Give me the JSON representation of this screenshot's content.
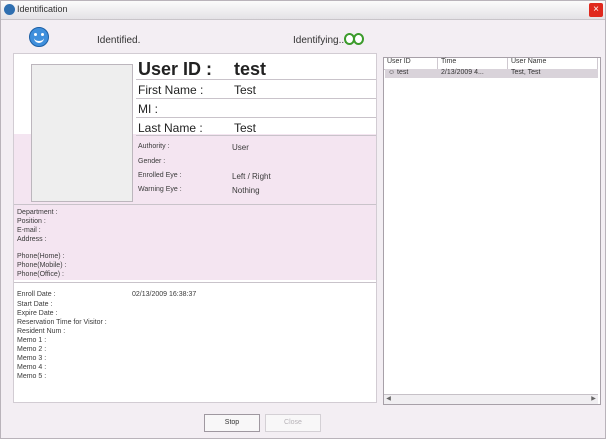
{
  "window": {
    "title": "Identification",
    "close_glyph": "×"
  },
  "status": {
    "identified": "Identified.",
    "identifying": "Identifying..."
  },
  "user": {
    "id_label": "User ID :",
    "id": "test",
    "first_name_label": "First Name :",
    "first_name": "Test",
    "mi_label": "MI :",
    "last_name_label": "Last Name :",
    "last_name": "Test"
  },
  "details": {
    "authority_label": "Authority :",
    "authority": "User",
    "gender_label": "Gender :",
    "enrolled_eye_label": "Enrolled Eye :",
    "enrolled_eye": "Left / Right",
    "warning_eye_label": "Warning Eye :",
    "warning_eye": "Nothing"
  },
  "contact": {
    "department": "Department :",
    "position": "Position :",
    "email": "E-mail :",
    "address": "Address :",
    "phone_home": "Phone(Home) :",
    "phone_mobile": "Phone(Mobile) :",
    "phone_office": "Phone(Office) :"
  },
  "extra": {
    "enroll_date_label": "Enroll Date :",
    "enroll_date": "02/13/2009 16:38:37",
    "start_date": "Start Date :",
    "expire_date": "Expire Date :",
    "reservation": "Reservation Time for Visitor :",
    "resident_num": "Resident Num :",
    "memo1": "Memo 1 :",
    "memo2": "Memo 2 :",
    "memo3": "Memo 3 :",
    "memo4": "Memo 4 :",
    "memo5": "Memo 5 :"
  },
  "log": {
    "columns": [
      "User ID",
      "Time",
      "User Name"
    ],
    "rows": [
      {
        "user_id": "test",
        "time": "2/13/2009 4...",
        "user_name": "Test, Test"
      }
    ]
  },
  "buttons": {
    "stop": "Stop",
    "close": "Close"
  },
  "colors": {
    "accent_band": "#f4e5f1",
    "eye_icon": "#3b9b2b",
    "smiley": "#3f8fdc",
    "close_red": "#e0291e"
  }
}
